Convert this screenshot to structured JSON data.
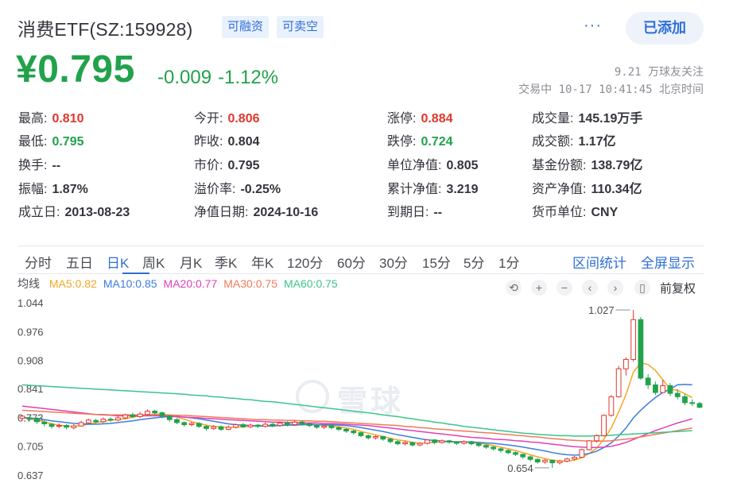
{
  "header": {
    "title": "消费ETF(SZ:159928)",
    "tags": [
      "可融资",
      "可卖空"
    ],
    "more": "···",
    "added_label": "已添加"
  },
  "price": {
    "last": "¥0.795",
    "change": "-0.009",
    "change_pct": "-1.12%",
    "followers": "9.21 万球友关注",
    "status": "交易中 10-17 10:41:45 北京时间"
  },
  "quote": {
    "rows": [
      [
        {
          "label": "最高:",
          "value": "0.810",
          "tone": "red"
        },
        {
          "label": "今开:",
          "value": "0.806",
          "tone": "red"
        },
        {
          "label": "涨停:",
          "value": "0.884",
          "tone": "red"
        },
        {
          "label": "成交量:",
          "value": "145.19万手",
          "tone": ""
        }
      ],
      [
        {
          "label": "最低:",
          "value": "0.795",
          "tone": "green"
        },
        {
          "label": "昨收:",
          "value": "0.804",
          "tone": ""
        },
        {
          "label": "跌停:",
          "value": "0.724",
          "tone": "green"
        },
        {
          "label": "成交额:",
          "value": "1.17亿",
          "tone": ""
        }
      ],
      [
        {
          "label": "换手:",
          "value": "--",
          "tone": ""
        },
        {
          "label": "市价:",
          "value": "0.795",
          "tone": ""
        },
        {
          "label": "单位净值:",
          "value": "0.805",
          "tone": ""
        },
        {
          "label": "基金份额:",
          "value": "138.79亿",
          "tone": ""
        }
      ],
      [
        {
          "label": "振幅:",
          "value": "1.87%",
          "tone": ""
        },
        {
          "label": "溢价率:",
          "value": "-0.25%",
          "tone": ""
        },
        {
          "label": "累计净值:",
          "value": "3.219",
          "tone": ""
        },
        {
          "label": "资产净值:",
          "value": "110.34亿",
          "tone": ""
        }
      ],
      [
        {
          "label": "成立日:",
          "value": "2013-08-23",
          "tone": ""
        },
        {
          "label": "净值日期:",
          "value": "2024-10-16",
          "tone": ""
        },
        {
          "label": "到期日:",
          "value": "--",
          "tone": ""
        },
        {
          "label": "货币单位:",
          "value": "CNY",
          "tone": ""
        }
      ]
    ]
  },
  "tabs": {
    "items": [
      "分时",
      "五日",
      "日K",
      "周K",
      "月K",
      "季K",
      "年K",
      "120分",
      "60分",
      "30分",
      "15分",
      "5分",
      "1分"
    ],
    "active": "日K",
    "stats_link": "区间统计",
    "fullscreen_link": "全屏显示"
  },
  "ma_legend": {
    "avg_label": "均线",
    "items": [
      {
        "label": "MA5:0.82",
        "color": "#f5a623"
      },
      {
        "label": "MA10:0.85",
        "color": "#3b7ddd"
      },
      {
        "label": "MA20:0.77",
        "color": "#e040b8"
      },
      {
        "label": "MA30:0.75",
        "color": "#f07a5a"
      },
      {
        "label": "MA60:0.75",
        "color": "#3cc48d"
      }
    ],
    "fuquan": "前复权"
  },
  "watermark": "雪球",
  "colors": {
    "up": "#e0372d",
    "down": "#21a24b",
    "accent": "#2f6fd6"
  },
  "chart_data": {
    "type": "candlestick",
    "y_ticks": [
      "1.044",
      "0.976",
      "0.908",
      "0.841",
      "0.773",
      "0.705",
      "0.637"
    ],
    "ylim": [
      0.637,
      1.044
    ],
    "annotations": [
      {
        "label": "1.027",
        "value": 1.027,
        "kind": "high"
      },
      {
        "label": "0.654",
        "value": 0.654,
        "kind": "low"
      }
    ],
    "candles": [
      [
        0.771,
        0.776,
        0.765,
        0.779
      ],
      [
        0.772,
        0.769,
        0.764,
        0.777
      ],
      [
        0.771,
        0.763,
        0.758,
        0.774
      ],
      [
        0.762,
        0.758,
        0.752,
        0.767
      ],
      [
        0.757,
        0.752,
        0.747,
        0.76
      ],
      [
        0.752,
        0.754,
        0.748,
        0.759
      ],
      [
        0.754,
        0.75,
        0.745,
        0.757
      ],
      [
        0.749,
        0.753,
        0.745,
        0.757
      ],
      [
        0.753,
        0.761,
        0.751,
        0.765
      ],
      [
        0.76,
        0.767,
        0.757,
        0.77
      ],
      [
        0.766,
        0.763,
        0.759,
        0.77
      ],
      [
        0.763,
        0.769,
        0.76,
        0.773
      ],
      [
        0.769,
        0.767,
        0.762,
        0.773
      ],
      [
        0.767,
        0.772,
        0.764,
        0.776
      ],
      [
        0.772,
        0.779,
        0.769,
        0.782
      ],
      [
        0.779,
        0.775,
        0.771,
        0.784
      ],
      [
        0.775,
        0.781,
        0.772,
        0.786
      ],
      [
        0.78,
        0.788,
        0.777,
        0.792
      ],
      [
        0.788,
        0.784,
        0.779,
        0.791
      ],
      [
        0.784,
        0.776,
        0.771,
        0.787
      ],
      [
        0.776,
        0.768,
        0.763,
        0.779
      ],
      [
        0.768,
        0.761,
        0.757,
        0.771
      ],
      [
        0.761,
        0.756,
        0.751,
        0.764
      ],
      [
        0.756,
        0.759,
        0.752,
        0.763
      ],
      [
        0.759,
        0.752,
        0.748,
        0.762
      ],
      [
        0.752,
        0.747,
        0.742,
        0.755
      ],
      [
        0.747,
        0.751,
        0.744,
        0.755
      ],
      [
        0.751,
        0.745,
        0.741,
        0.754
      ],
      [
        0.745,
        0.75,
        0.743,
        0.754
      ],
      [
        0.75,
        0.756,
        0.747,
        0.759
      ],
      [
        0.756,
        0.751,
        0.748,
        0.76
      ],
      [
        0.751,
        0.755,
        0.748,
        0.759
      ],
      [
        0.755,
        0.752,
        0.748,
        0.758
      ],
      [
        0.752,
        0.757,
        0.749,
        0.761
      ],
      [
        0.757,
        0.754,
        0.75,
        0.76
      ],
      [
        0.754,
        0.76,
        0.751,
        0.763
      ],
      [
        0.76,
        0.756,
        0.752,
        0.764
      ],
      [
        0.756,
        0.762,
        0.753,
        0.766
      ],
      [
        0.762,
        0.758,
        0.754,
        0.766
      ],
      [
        0.758,
        0.754,
        0.75,
        0.761
      ],
      [
        0.754,
        0.75,
        0.746,
        0.757
      ],
      [
        0.75,
        0.753,
        0.746,
        0.756
      ],
      [
        0.753,
        0.749,
        0.745,
        0.756
      ],
      [
        0.749,
        0.745,
        0.741,
        0.752
      ],
      [
        0.745,
        0.741,
        0.737,
        0.748
      ],
      [
        0.741,
        0.737,
        0.733,
        0.744
      ],
      [
        0.737,
        0.73,
        0.726,
        0.739
      ],
      [
        0.73,
        0.725,
        0.721,
        0.733
      ],
      [
        0.725,
        0.728,
        0.721,
        0.731
      ],
      [
        0.728,
        0.722,
        0.718,
        0.73
      ],
      [
        0.722,
        0.716,
        0.712,
        0.725
      ],
      [
        0.716,
        0.711,
        0.707,
        0.719
      ],
      [
        0.711,
        0.714,
        0.707,
        0.717
      ],
      [
        0.714,
        0.708,
        0.704,
        0.716
      ],
      [
        0.708,
        0.712,
        0.705,
        0.715
      ],
      [
        0.712,
        0.72,
        0.709,
        0.722
      ],
      [
        0.72,
        0.714,
        0.71,
        0.722
      ],
      [
        0.714,
        0.718,
        0.711,
        0.721
      ],
      [
        0.718,
        0.715,
        0.711,
        0.72
      ],
      [
        0.715,
        0.712,
        0.708,
        0.717
      ],
      [
        0.712,
        0.716,
        0.709,
        0.719
      ],
      [
        0.716,
        0.711,
        0.707,
        0.718
      ],
      [
        0.711,
        0.707,
        0.703,
        0.714
      ],
      [
        0.707,
        0.703,
        0.699,
        0.71
      ],
      [
        0.703,
        0.699,
        0.695,
        0.706
      ],
      [
        0.699,
        0.695,
        0.69,
        0.702
      ],
      [
        0.695,
        0.69,
        0.686,
        0.698
      ],
      [
        0.69,
        0.686,
        0.682,
        0.693
      ],
      [
        0.686,
        0.68,
        0.675,
        0.688
      ],
      [
        0.68,
        0.674,
        0.669,
        0.683
      ],
      [
        0.674,
        0.668,
        0.664,
        0.677
      ],
      [
        0.668,
        0.672,
        0.664,
        0.675
      ],
      [
        0.672,
        0.666,
        0.654,
        0.674
      ],
      [
        0.666,
        0.67,
        0.662,
        0.673
      ],
      [
        0.67,
        0.675,
        0.667,
        0.678
      ],
      [
        0.675,
        0.679,
        0.672,
        0.682
      ],
      [
        0.679,
        0.697,
        0.677,
        0.699
      ],
      [
        0.697,
        0.718,
        0.695,
        0.72
      ],
      [
        0.718,
        0.73,
        0.714,
        0.733
      ],
      [
        0.73,
        0.778,
        0.728,
        0.78
      ],
      [
        0.778,
        0.822,
        0.775,
        0.826
      ],
      [
        0.822,
        0.888,
        0.82,
        0.895
      ],
      [
        0.888,
        0.91,
        0.872,
        0.915
      ],
      [
        0.91,
        1.004,
        0.905,
        1.027
      ],
      [
        1.004,
        0.866,
        0.862,
        1.01
      ],
      [
        0.866,
        0.85,
        0.84,
        0.875
      ],
      [
        0.85,
        0.832,
        0.826,
        0.858
      ],
      [
        0.832,
        0.848,
        0.83,
        0.862
      ],
      [
        0.848,
        0.83,
        0.824,
        0.854
      ],
      [
        0.83,
        0.822,
        0.816,
        0.84
      ],
      [
        0.822,
        0.808,
        0.802,
        0.828
      ],
      [
        0.808,
        0.806,
        0.8,
        0.816
      ],
      [
        0.806,
        0.797,
        0.795,
        0.81
      ]
    ],
    "candle_order": "open, close, low, high",
    "series": [
      {
        "name": "MA5",
        "color": "#f5a623",
        "values": [
          0.772,
          0.77,
          0.767,
          0.763,
          0.758,
          0.755,
          0.753,
          0.752,
          0.754,
          0.757,
          0.761,
          0.763,
          0.767,
          0.768,
          0.77,
          0.774,
          0.776,
          0.779,
          0.781,
          0.781,
          0.778,
          0.774,
          0.769,
          0.763,
          0.759,
          0.755,
          0.752,
          0.751,
          0.749,
          0.75,
          0.751,
          0.752,
          0.754,
          0.754,
          0.755,
          0.756,
          0.756,
          0.757,
          0.758,
          0.758,
          0.756,
          0.755,
          0.753,
          0.751,
          0.748,
          0.745,
          0.74,
          0.736,
          0.732,
          0.728,
          0.724,
          0.72,
          0.718,
          0.714,
          0.712,
          0.713,
          0.714,
          0.715,
          0.716,
          0.716,
          0.716,
          0.714,
          0.712,
          0.71,
          0.707,
          0.703,
          0.699,
          0.695,
          0.69,
          0.685,
          0.68,
          0.676,
          0.672,
          0.67,
          0.67,
          0.672,
          0.678,
          0.688,
          0.7,
          0.722,
          0.748,
          0.786,
          0.827,
          0.88,
          0.902,
          0.898,
          0.884,
          0.862,
          0.84,
          0.837,
          0.829,
          0.82
        ]
      },
      {
        "name": "MA10",
        "color": "#3b7ddd",
        "values": [
          0.773,
          0.772,
          0.77,
          0.768,
          0.765,
          0.763,
          0.761,
          0.759,
          0.758,
          0.757,
          0.757,
          0.758,
          0.759,
          0.761,
          0.763,
          0.765,
          0.768,
          0.77,
          0.772,
          0.774,
          0.775,
          0.775,
          0.774,
          0.772,
          0.77,
          0.767,
          0.764,
          0.761,
          0.758,
          0.756,
          0.755,
          0.754,
          0.753,
          0.753,
          0.753,
          0.754,
          0.755,
          0.755,
          0.756,
          0.756,
          0.756,
          0.756,
          0.756,
          0.755,
          0.754,
          0.752,
          0.749,
          0.746,
          0.743,
          0.74,
          0.736,
          0.732,
          0.729,
          0.726,
          0.723,
          0.72,
          0.719,
          0.717,
          0.716,
          0.715,
          0.715,
          0.715,
          0.714,
          0.713,
          0.712,
          0.71,
          0.708,
          0.706,
          0.703,
          0.7,
          0.697,
          0.694,
          0.69,
          0.687,
          0.685,
          0.684,
          0.685,
          0.688,
          0.693,
          0.702,
          0.713,
          0.729,
          0.748,
          0.772,
          0.79,
          0.806,
          0.82,
          0.832,
          0.84,
          0.85,
          0.851,
          0.85
        ]
      },
      {
        "name": "MA20",
        "color": "#e040b8",
        "values": [
          0.8,
          0.798,
          0.796,
          0.794,
          0.792,
          0.79,
          0.788,
          0.786,
          0.784,
          0.782,
          0.78,
          0.779,
          0.778,
          0.777,
          0.777,
          0.777,
          0.777,
          0.777,
          0.777,
          0.777,
          0.776,
          0.775,
          0.774,
          0.773,
          0.772,
          0.771,
          0.77,
          0.769,
          0.768,
          0.767,
          0.766,
          0.765,
          0.764,
          0.763,
          0.762,
          0.762,
          0.761,
          0.761,
          0.76,
          0.76,
          0.76,
          0.759,
          0.759,
          0.758,
          0.757,
          0.756,
          0.755,
          0.754,
          0.752,
          0.75,
          0.748,
          0.746,
          0.744,
          0.742,
          0.74,
          0.738,
          0.736,
          0.734,
          0.732,
          0.73,
          0.728,
          0.726,
          0.725,
          0.724,
          0.722,
          0.721,
          0.72,
          0.718,
          0.717,
          0.715,
          0.714,
          0.712,
          0.71,
          0.708,
          0.706,
          0.704,
          0.703,
          0.702,
          0.702,
          0.703,
          0.705,
          0.709,
          0.714,
          0.721,
          0.728,
          0.735,
          0.742,
          0.748,
          0.754,
          0.76,
          0.765,
          0.77
        ]
      },
      {
        "name": "MA30",
        "color": "#f07a5a",
        "values": [
          0.79,
          0.789,
          0.788,
          0.787,
          0.786,
          0.785,
          0.784,
          0.783,
          0.782,
          0.781,
          0.78,
          0.78,
          0.779,
          0.779,
          0.779,
          0.779,
          0.779,
          0.779,
          0.779,
          0.779,
          0.779,
          0.778,
          0.778,
          0.777,
          0.776,
          0.775,
          0.774,
          0.773,
          0.772,
          0.771,
          0.77,
          0.769,
          0.768,
          0.768,
          0.767,
          0.767,
          0.766,
          0.766,
          0.765,
          0.765,
          0.764,
          0.764,
          0.763,
          0.762,
          0.761,
          0.76,
          0.759,
          0.758,
          0.757,
          0.756,
          0.755,
          0.754,
          0.752,
          0.751,
          0.749,
          0.748,
          0.746,
          0.745,
          0.744,
          0.742,
          0.741,
          0.74,
          0.738,
          0.737,
          0.736,
          0.734,
          0.733,
          0.731,
          0.73,
          0.728,
          0.727,
          0.725,
          0.723,
          0.722,
          0.72,
          0.719,
          0.718,
          0.717,
          0.717,
          0.717,
          0.718,
          0.72,
          0.722,
          0.724,
          0.727,
          0.73,
          0.733,
          0.736,
          0.739,
          0.742,
          0.745,
          0.748
        ]
      },
      {
        "name": "MA60",
        "color": "#3cc48d",
        "values": [
          0.85,
          0.849,
          0.848,
          0.847,
          0.846,
          0.845,
          0.844,
          0.843,
          0.842,
          0.841,
          0.84,
          0.839,
          0.838,
          0.837,
          0.836,
          0.835,
          0.834,
          0.833,
          0.832,
          0.831,
          0.83,
          0.829,
          0.828,
          0.826,
          0.825,
          0.824,
          0.822,
          0.821,
          0.819,
          0.818,
          0.816,
          0.815,
          0.813,
          0.811,
          0.81,
          0.808,
          0.806,
          0.804,
          0.802,
          0.8,
          0.798,
          0.796,
          0.794,
          0.792,
          0.79,
          0.788,
          0.786,
          0.784,
          0.782,
          0.779,
          0.777,
          0.775,
          0.772,
          0.77,
          0.767,
          0.765,
          0.762,
          0.76,
          0.757,
          0.755,
          0.752,
          0.75,
          0.748,
          0.746,
          0.744,
          0.742,
          0.74,
          0.738,
          0.736,
          0.735,
          0.733,
          0.732,
          0.731,
          0.73,
          0.73,
          0.729,
          0.729,
          0.729,
          0.73,
          0.73,
          0.731,
          0.732,
          0.733,
          0.734,
          0.735,
          0.736,
          0.737,
          0.738,
          0.739,
          0.74,
          0.741,
          0.742
        ]
      }
    ]
  }
}
